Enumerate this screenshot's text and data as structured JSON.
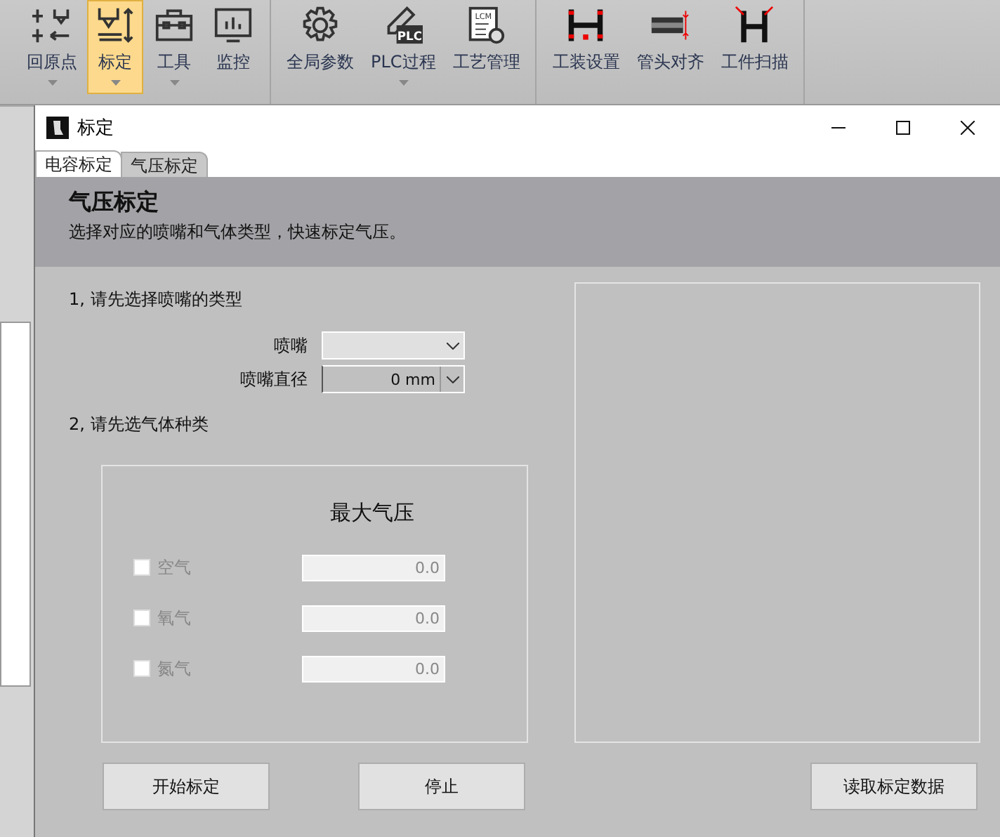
{
  "ribbon": {
    "groups": [
      {
        "items": [
          {
            "label": "回原点",
            "dropdown": true,
            "selected": false
          },
          {
            "label": "标定",
            "dropdown": true,
            "selected": true
          },
          {
            "label": "工具",
            "dropdown": true,
            "selected": false
          },
          {
            "label": "监控",
            "dropdown": false,
            "selected": false
          }
        ]
      },
      {
        "items": [
          {
            "label": "全局参数",
            "dropdown": false,
            "selected": false
          },
          {
            "label": "PLC过程",
            "icon_text": "PLC",
            "dropdown": true,
            "selected": false
          },
          {
            "label": "工艺管理",
            "icon_text": "LCM",
            "dropdown": false,
            "selected": false
          }
        ]
      },
      {
        "items": [
          {
            "label": "工装设置",
            "dropdown": false,
            "selected": false
          },
          {
            "label": "管头对齐",
            "dropdown": false,
            "selected": false
          },
          {
            "label": "工件扫描",
            "dropdown": false,
            "selected": false
          }
        ]
      }
    ]
  },
  "dialog": {
    "title": "标定",
    "tabs": [
      {
        "label": "电容标定",
        "selected": true
      },
      {
        "label": "气压标定",
        "selected": false
      }
    ],
    "header": {
      "title": "气压标定",
      "subtitle": "选择对应的喷嘴和气体类型，快速标定气压。"
    },
    "step1": "1, 请先选择喷嘴的类型",
    "fields": [
      {
        "label": "喷嘴",
        "kind": "dropdown"
      },
      {
        "label": "喷嘴直径",
        "kind": "spin",
        "value": "0 mm"
      }
    ],
    "step2": "2, 请先选气体种类",
    "gas_group": {
      "heading": "最大气压",
      "gases": [
        {
          "label": "空气",
          "checked": false,
          "disabled": true,
          "value": "0.0"
        },
        {
          "label": "氧气",
          "checked": false,
          "disabled": true,
          "value": "0.0"
        },
        {
          "label": "氮气",
          "checked": false,
          "disabled": true,
          "value": "0.0"
        }
      ]
    },
    "buttons": {
      "left": [
        "开始标定",
        "停止"
      ],
      "right": [
        "读取标定数据"
      ]
    }
  }
}
